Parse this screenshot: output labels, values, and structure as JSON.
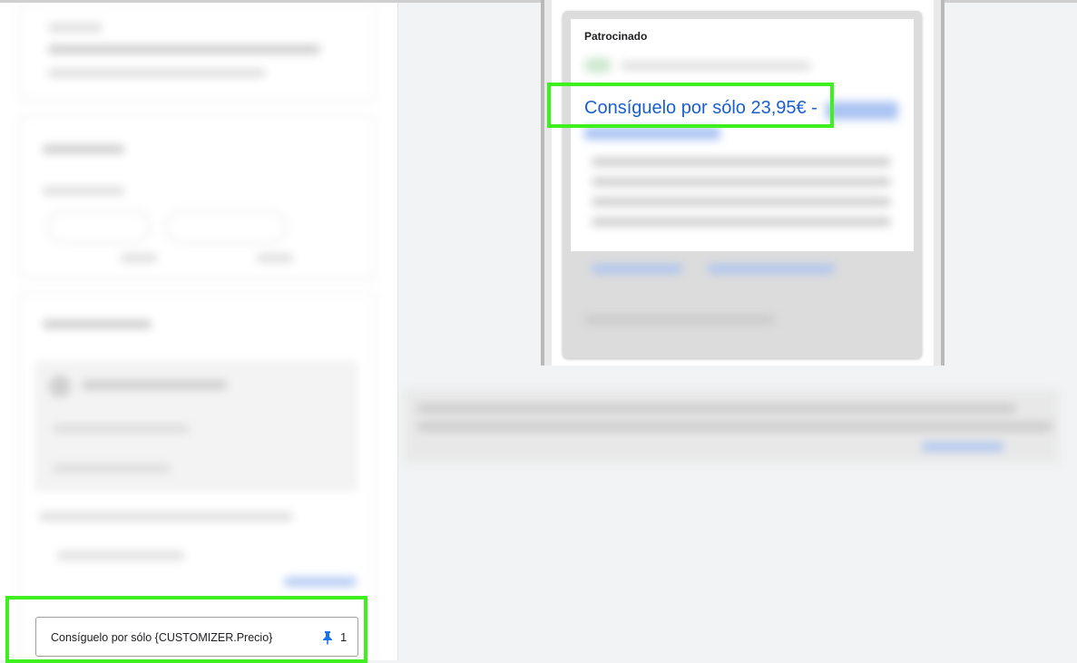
{
  "editor": {
    "headline_field": {
      "value": "Consíguelo por sólo {CUSTOMIZER.Precio}",
      "pin_icon": "pin-icon",
      "pin_count": "1"
    }
  },
  "preview": {
    "sponsored_label": "Patrocinado",
    "headline": "Consíguelo por sólo 23,95€ -"
  },
  "colors": {
    "highlight": "#3ef01d",
    "link_blue": "#1a5fd0",
    "pin_blue": "#1a73e8"
  }
}
